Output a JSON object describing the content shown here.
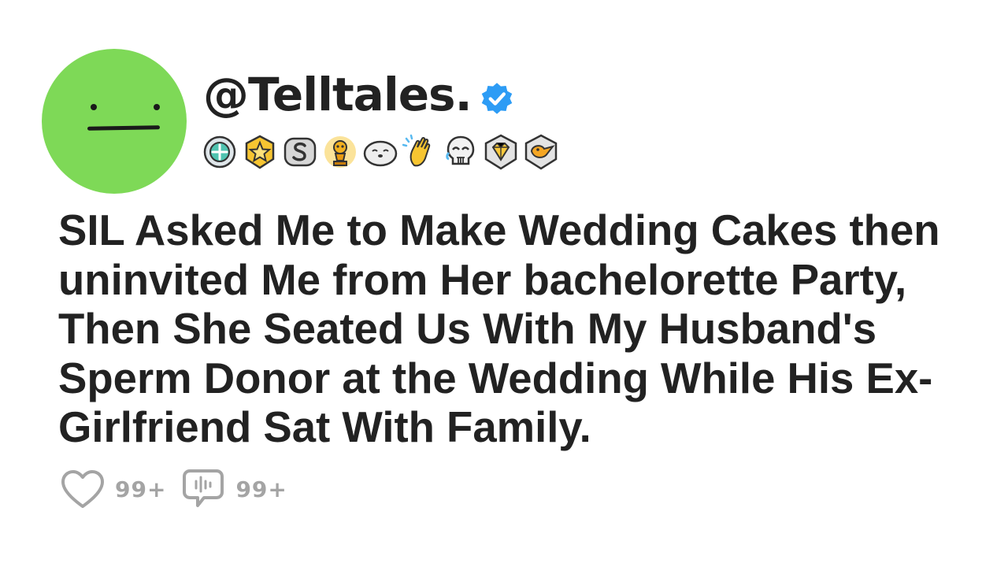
{
  "post": {
    "handle": "@Telltales.",
    "title": "SIL Asked Me to Make Wedding Cakes then uninvited Me from Her bachelorette Party, Then She Seated Us With My Husband's Sperm Donor at the Wedding While His Ex-Girlfriend Sat With Family.",
    "avatar": {
      "color": "#7ed957"
    },
    "verified_color": "#2d9cf5",
    "badges": [
      "compass-award-icon",
      "gold-star-award-icon",
      "silver-s-award-icon",
      "gold-snoo-trophy-icon",
      "seal-award-icon",
      "clapping-hands-icon",
      "laughing-skull-icon",
      "gold-diamond-award-icon",
      "duck-award-icon"
    ]
  },
  "footer": {
    "likes": "99+",
    "comments": "99+"
  }
}
